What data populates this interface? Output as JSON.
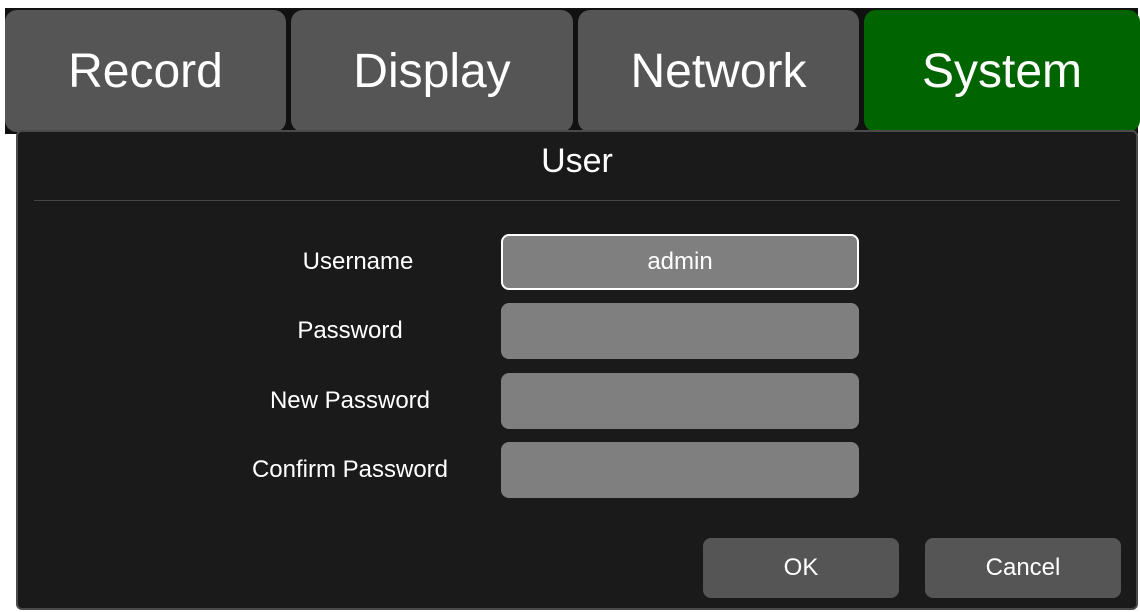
{
  "tabs": [
    {
      "label": "Record",
      "active": false
    },
    {
      "label": "Display",
      "active": false
    },
    {
      "label": "Network",
      "active": false
    },
    {
      "label": "System",
      "active": true
    }
  ],
  "colors": {
    "tab_active": "#006400",
    "tab_inactive": "#555555",
    "panel_bg": "#1a1a1a",
    "input_bg": "#7f7f7f",
    "text": "#ffffff"
  },
  "panel": {
    "title": "User"
  },
  "fields": [
    {
      "label": "Username",
      "value": "admin",
      "focused": true
    },
    {
      "label": "Password",
      "value": "",
      "focused": false
    },
    {
      "label": "New Password",
      "value": "",
      "focused": false
    },
    {
      "label": "Confirm Password",
      "value": "",
      "focused": false
    }
  ],
  "buttons": {
    "ok_label": "OK",
    "cancel_label": "Cancel"
  }
}
